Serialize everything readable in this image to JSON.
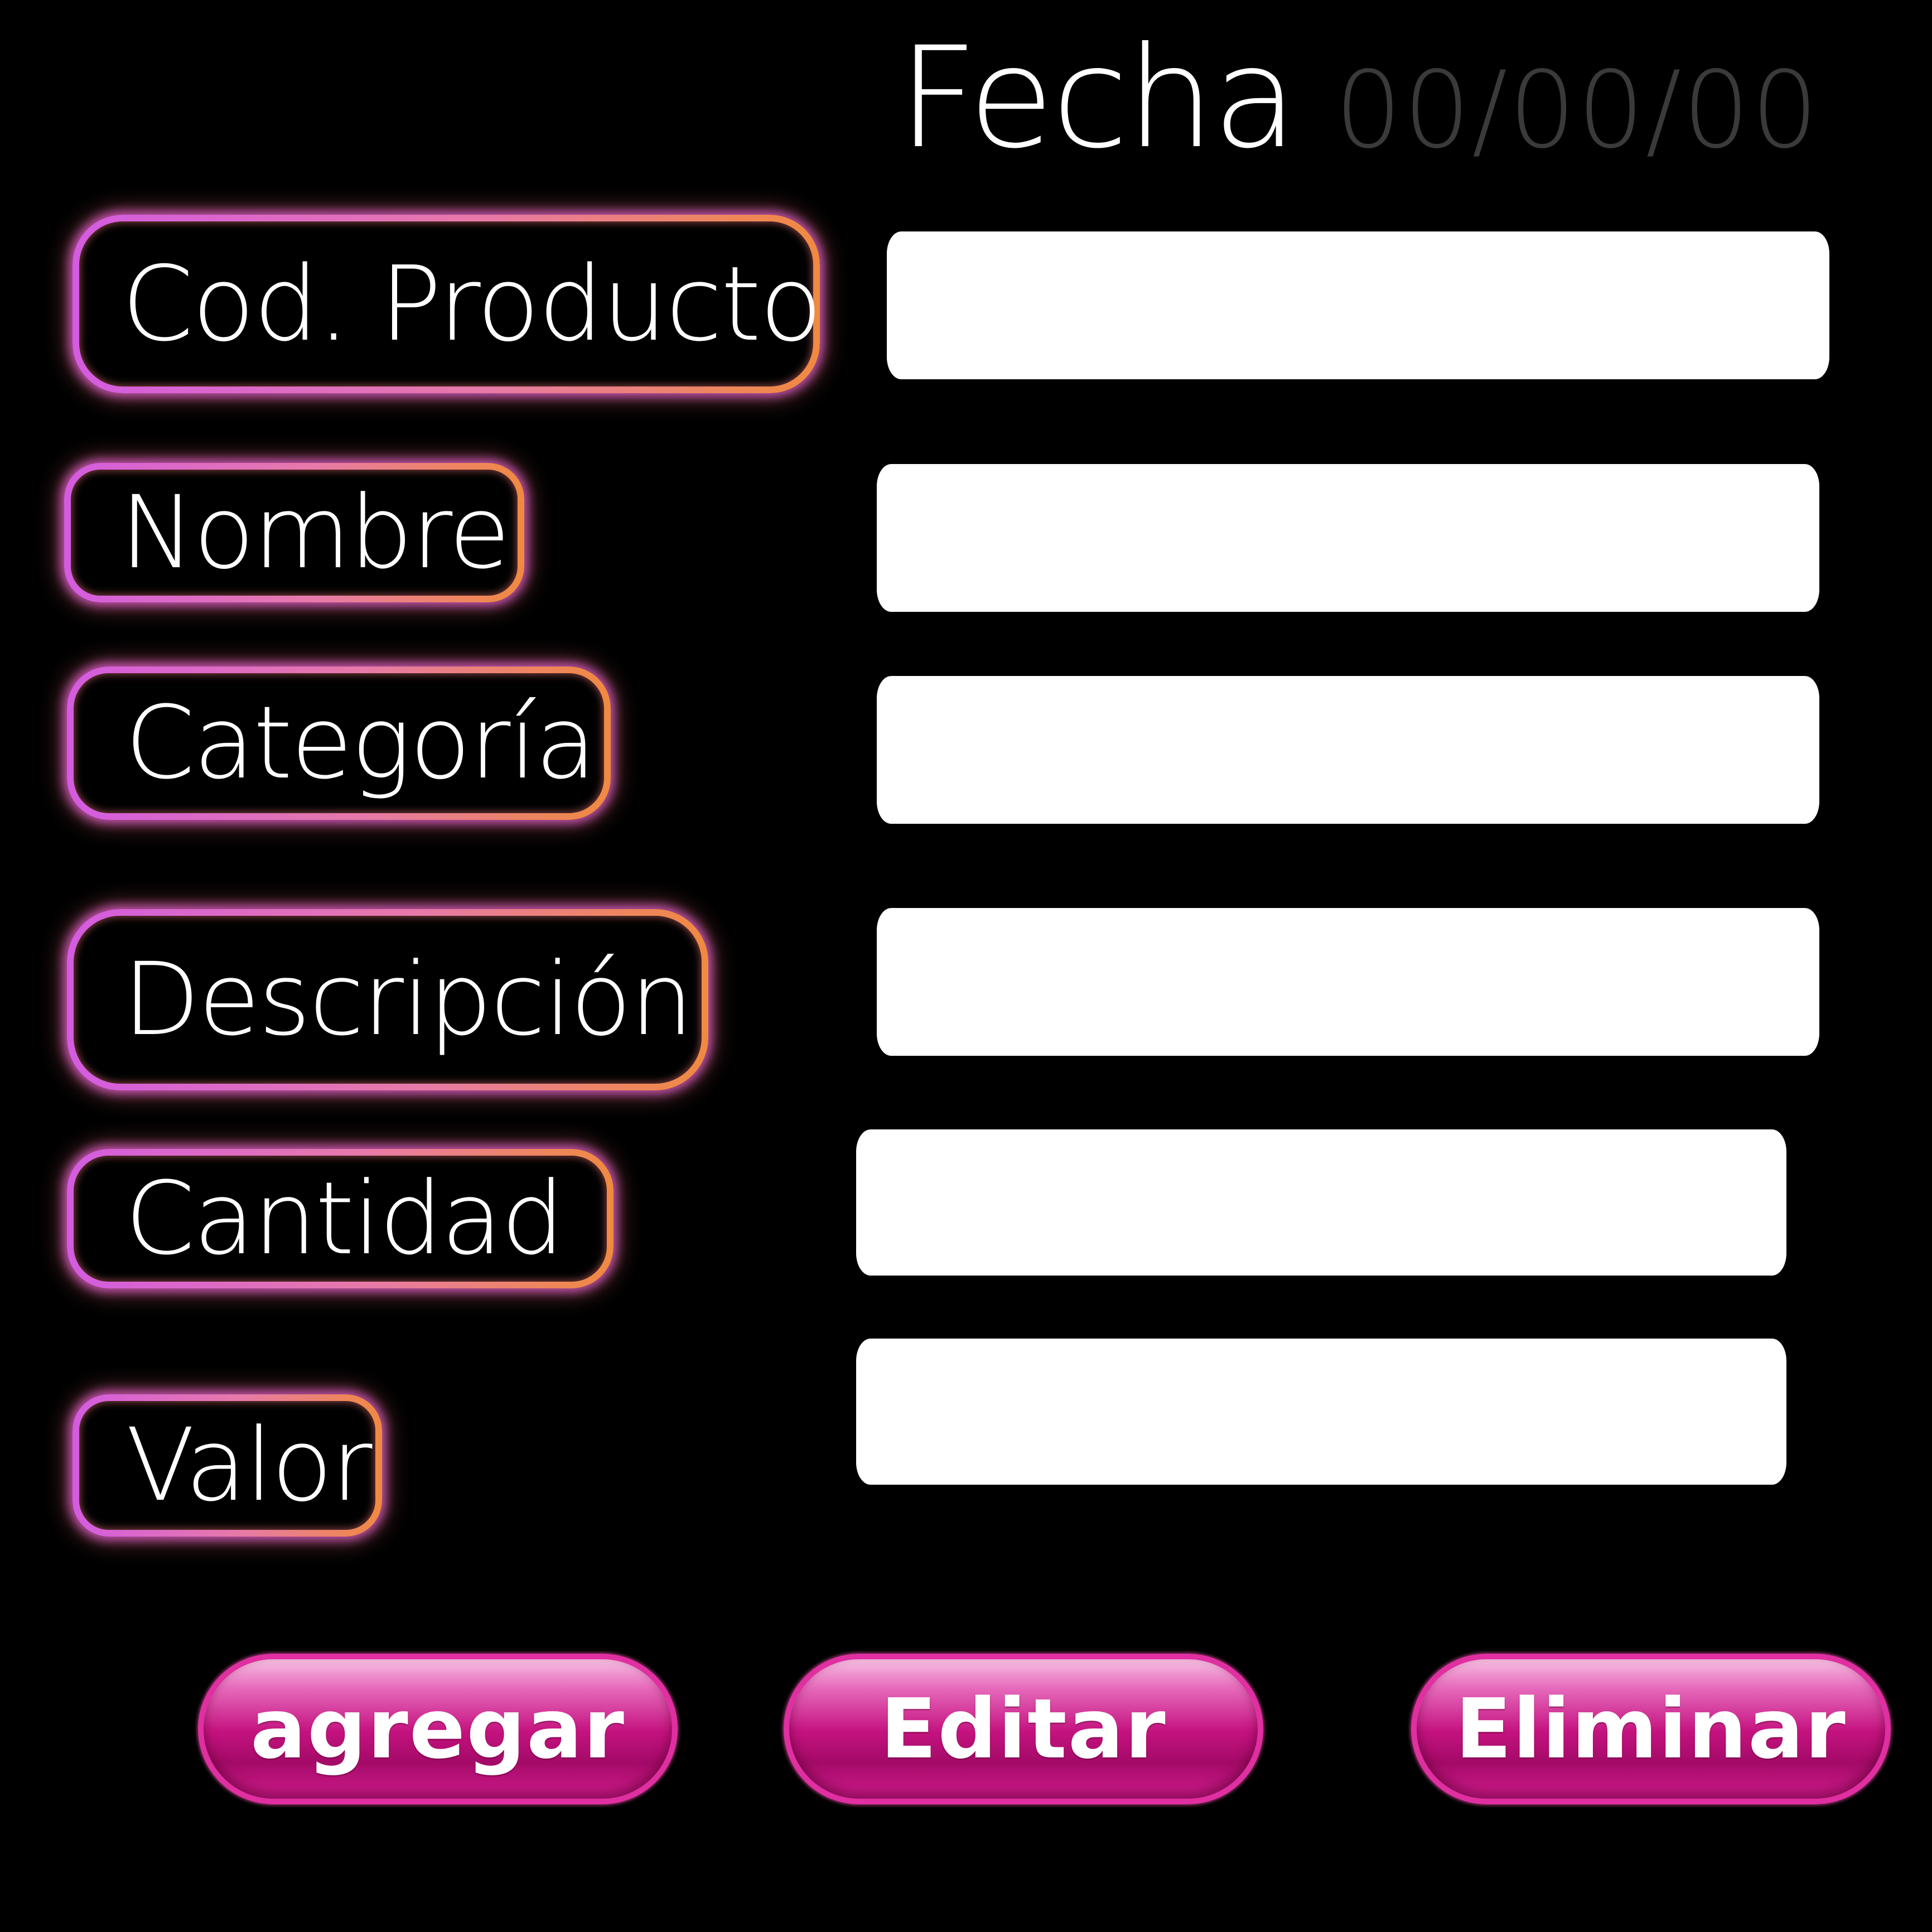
{
  "header": {
    "date_label": "Fecha",
    "date_value": "00/00/00"
  },
  "form": {
    "fields": [
      {
        "label": "Cod. Producto",
        "value": ""
      },
      {
        "label": "Nombre",
        "value": ""
      },
      {
        "label": "Categoría",
        "value": ""
      },
      {
        "label": "Descripción",
        "value": ""
      },
      {
        "label": "Cantidad",
        "value": ""
      },
      {
        "label": "Valor",
        "value": ""
      }
    ]
  },
  "actions": {
    "add_label": "agregar",
    "edit_label": "Editar",
    "delete_label": "Eliminar"
  },
  "colors": {
    "background": "#000000",
    "label_glow_left": "#d35ce0",
    "label_glow_right": "#f08a40",
    "button_magenta": "#c4127f",
    "date_placeholder": "#3a3a3a"
  }
}
